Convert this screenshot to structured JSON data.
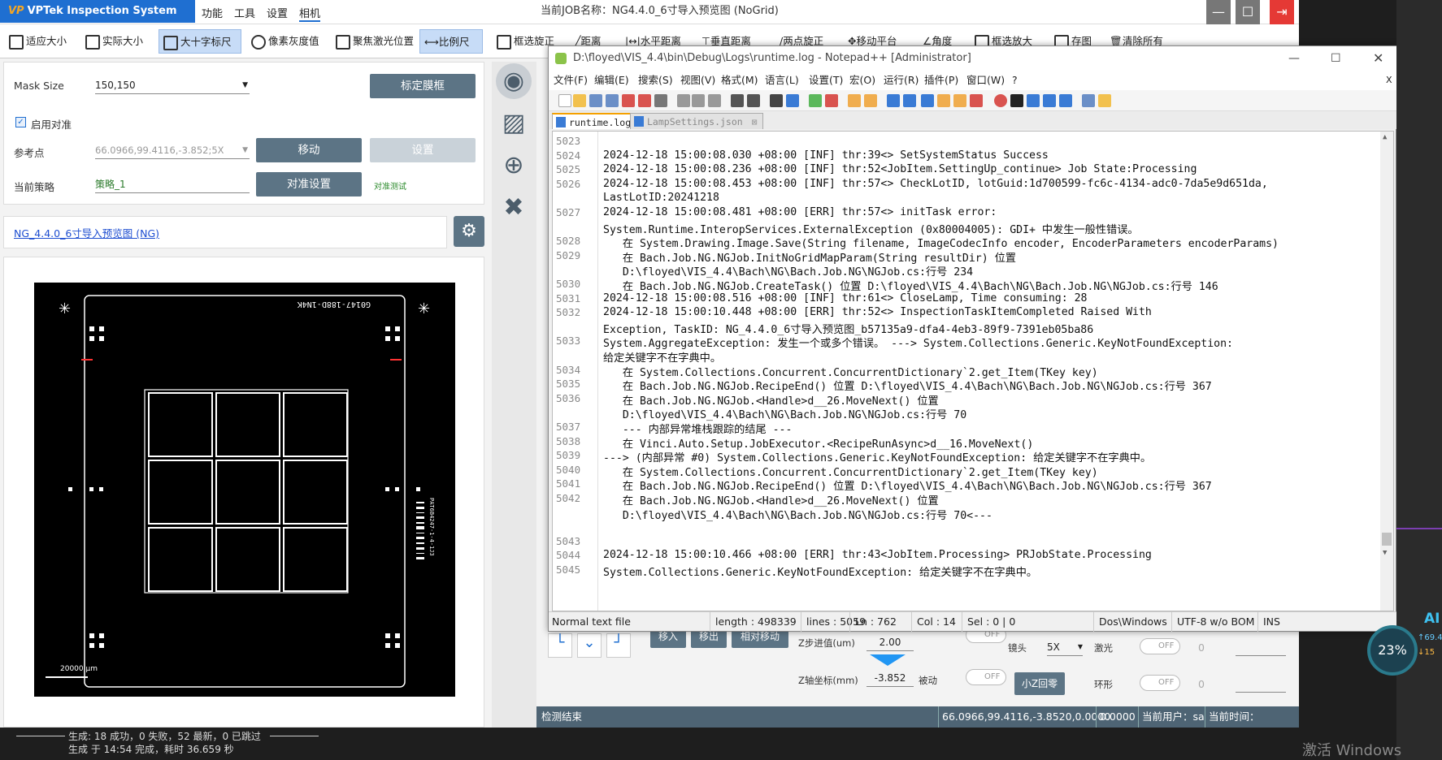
{
  "app": {
    "logo": "VPTek Inspection System 1.0.0.0",
    "logo_mark": "VP",
    "menus": [
      "功能",
      "工具",
      "设置",
      "相机"
    ],
    "job_title": "当前JOB名称：NG4.4.0_6寸导入预览图 (NoGrid)"
  },
  "toolbar": [
    "适应大小",
    "实际大小",
    "大十字标尺",
    "像素灰度值",
    "聚焦激光位置",
    "比例尺",
    "框选旋正",
    "距离",
    "水平距离",
    "垂直距离",
    "两点旋正",
    "移动平台",
    "角度",
    "框选放大",
    "存图",
    "清除所有"
  ],
  "left": {
    "mask_label": "Mask Size",
    "mask_value": "150,150",
    "calib_btn": "标定膜框",
    "enable_align": "启用对准",
    "ref_label": "参考点",
    "ref_value": "66.0966,99.4116,-3.852;5X",
    "move_btn": "移动",
    "set_btn": "设置",
    "strategy_label": "当前策略",
    "strategy_value": "策略_1",
    "align_btn": "对准设置",
    "align_test": "对准测试",
    "job_link": "NG_4.4.0_6寸导入预览图 (NG)",
    "board_id": "G0147-188D-1N4K",
    "scale": "20000 μm",
    "barcode_text": "PAT6B4247-1-4-1J3"
  },
  "npp": {
    "title": "D:\\floyed\\VIS_4.4\\bin\\Debug\\Logs\\runtime.log - Notepad++ [Administrator]",
    "menu": [
      "文件(F)",
      "编辑(E)",
      "搜索(S)",
      "视图(V)",
      "格式(M)",
      "语言(L)",
      "设置(T)",
      "宏(O)",
      "运行(R)",
      "插件(P)",
      "窗口(W)",
      "?"
    ],
    "close_x": "X",
    "tabs": [
      "runtime.log",
      "LampSettings.json"
    ],
    "lines": [
      {
        "n": "5023",
        "t": ""
      },
      {
        "n": "5024",
        "t": "2024-12-18 15:00:08.030 +08:00 [INF] thr:39<> SetSystemStatus Success"
      },
      {
        "n": "5025",
        "t": "2024-12-18 15:00:08.236 +08:00 [INF] thr:52<JobItem.SettingUp_continue> Job State:Processing"
      },
      {
        "n": "5026",
        "t": "2024-12-18 15:00:08.453 +08:00 [INF] thr:57<> CheckLotID, lotGuid:1d700599-fc6c-4134-adc0-7da5e9d651da,"
      },
      {
        "n": "",
        "t": "LastLotID:20241218"
      },
      {
        "n": "5027",
        "t": "2024-12-18 15:00:08.481 +08:00 [ERR] thr:57<> initTask error:"
      },
      {
        "n": "",
        "t": "System.Runtime.InteropServices.ExternalException (0x80004005): GDI+ 中发生一般性错误。"
      },
      {
        "n": "5028",
        "t": "   在 System.Drawing.Image.Save(String filename, ImageCodecInfo encoder, EncoderParameters encoderParams)"
      },
      {
        "n": "5029",
        "t": "   在 Bach.Job.NG.NGJob.InitNoGridMapParam(String resultDir) 位置"
      },
      {
        "n": "",
        "t": "   D:\\floyed\\VIS_4.4\\Bach\\NG\\Bach.Job.NG\\NGJob.cs:行号 234"
      },
      {
        "n": "5030",
        "t": "   在 Bach.Job.NG.NGJob.CreateTask() 位置 D:\\floyed\\VIS_4.4\\Bach\\NG\\Bach.Job.NG\\NGJob.cs:行号 146"
      },
      {
        "n": "5031",
        "t": "2024-12-18 15:00:08.516 +08:00 [INF] thr:61<> CloseLamp, Time consuming: 28"
      },
      {
        "n": "5032",
        "t": "2024-12-18 15:00:10.448 +08:00 [ERR] thr:52<> InspectionTaskItemCompleted Raised With"
      },
      {
        "n": "",
        "t": "Exception, TaskID: NG_4.4.0_6寸导入预览图_b57135a9-dfa4-4eb3-89f9-7391eb05ba86"
      },
      {
        "n": "5033",
        "t": "System.AggregateException: 发生一个或多个错误。 ---> System.Collections.Generic.KeyNotFoundException:"
      },
      {
        "n": "",
        "t": "给定关键字不在字典中。"
      },
      {
        "n": "5034",
        "t": "   在 System.Collections.Concurrent.ConcurrentDictionary`2.get_Item(TKey key)"
      },
      {
        "n": "5035",
        "t": "   在 Bach.Job.NG.NGJob.RecipeEnd() 位置 D:\\floyed\\VIS_4.4\\Bach\\NG\\Bach.Job.NG\\NGJob.cs:行号 367"
      },
      {
        "n": "5036",
        "t": "   在 Bach.Job.NG.NGJob.<Handle>d__26.MoveNext() 位置"
      },
      {
        "n": "",
        "t": "   D:\\floyed\\VIS_4.4\\Bach\\NG\\Bach.Job.NG\\NGJob.cs:行号 70"
      },
      {
        "n": "5037",
        "t": "   --- 内部异常堆栈跟踪的结尾 ---"
      },
      {
        "n": "5038",
        "t": "   在 Vinci.Auto.Setup.JobExecutor.<RecipeRunAsync>d__16.MoveNext()"
      },
      {
        "n": "5039",
        "t": "---> (内部异常 #0) System.Collections.Generic.KeyNotFoundException: 给定关键字不在字典中。"
      },
      {
        "n": "5040",
        "t": "   在 System.Collections.Concurrent.ConcurrentDictionary`2.get_Item(TKey key)"
      },
      {
        "n": "5041",
        "t": "   在 Bach.Job.NG.NGJob.RecipeEnd() 位置 D:\\floyed\\VIS_4.4\\Bach\\NG\\Bach.Job.NG\\NGJob.cs:行号 367"
      },
      {
        "n": "5042",
        "t": "   在 Bach.Job.NG.NGJob.<Handle>d__26.MoveNext() 位置"
      },
      {
        "n": "",
        "t": "   D:\\floyed\\VIS_4.4\\Bach\\NG\\Bach.Job.NG\\NGJob.cs:行号 70<---"
      },
      {
        "n": "",
        "t": ""
      },
      {
        "n": "5043",
        "t": ""
      },
      {
        "n": "5044",
        "t": "2024-12-18 15:00:10.466 +08:00 [ERR] thr:43<JobItem.Processing> PRJobState.Processing"
      },
      {
        "n": "5045",
        "t": "System.Collections.Generic.KeyNotFoundException: 给定关键字不在字典中。"
      }
    ],
    "status": {
      "type": "Normal text file",
      "length": "length : 498339",
      "lines": "lines : 5059",
      "ln": "Ln : 762",
      "col": "Col : 14",
      "sel": "Sel : 0 | 0",
      "eol": "Dos\\Windows",
      "enc": "UTF-8 w/o BOM",
      "ins": "INS"
    }
  },
  "ctrl": {
    "zstep_label": "Z步进值(um)",
    "zstep_value": "2.00",
    "zaxis_label": "Z轴坐标(mm)",
    "zaxis_value": "-3.852",
    "passive": "被动",
    "off": "OFF",
    "z_home": "小Z回零",
    "lens_label": "镜头",
    "lens_value": "5X",
    "laser_label": "激光",
    "ring_label": "环形",
    "zero": "0",
    "move_in": "移入",
    "move_out": "移出",
    "rel_move": "相对移动"
  },
  "status": {
    "left": "检测结束",
    "coords": "66.0966,99.4116,-3.8520,0.0000",
    "val": "0.0000",
    "user": "当前用户：sa",
    "time": "当前时间：15:01:54"
  },
  "build": {
    "line1": "生成: 18 成功，0 失败，52 最新，0 已跳过",
    "line2": "生成 于 14:54 完成，耗时 36.659 秒"
  },
  "desk": {
    "ai": "AI",
    "pct": "23%",
    "up": "69.4",
    "down": "15",
    "activate": "激活 Windows"
  }
}
